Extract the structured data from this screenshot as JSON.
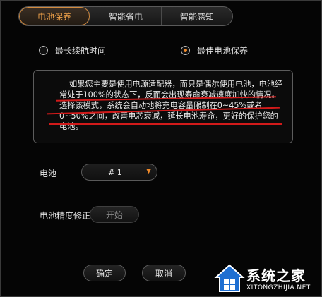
{
  "tabs": [
    {
      "label": "电池保养",
      "active": true
    },
    {
      "label": "智能省电",
      "active": false
    },
    {
      "label": "智能感知",
      "active": false
    }
  ],
  "options": {
    "longest": {
      "label": "最长续航时间",
      "checked": false
    },
    "best": {
      "label": "最佳电池保养",
      "checked": true
    }
  },
  "description": {
    "text": "如果您主要是使用电源适配器，而只是偶尔使用电池，电池经常处于100%的状态下，反而会出现寿命衰减速度加快的情况。选择该模式，系统会自动地将充电容量限制在0~45%或者0~50%之间，改善电芯衰减，延长电池寿命，更好的保护您的电池。"
  },
  "battery": {
    "label": "电池",
    "value": "#    1"
  },
  "calibration": {
    "label": "电池精度修正",
    "start_label": "开始"
  },
  "buttons": {
    "ok": "确定",
    "cancel": "取消"
  },
  "watermark": {
    "name": "系统之家",
    "url": "XITONGZHIJIA.NET"
  },
  "colors": {
    "accent": "#f08a2a",
    "annotation_red": "#d11a1a"
  }
}
